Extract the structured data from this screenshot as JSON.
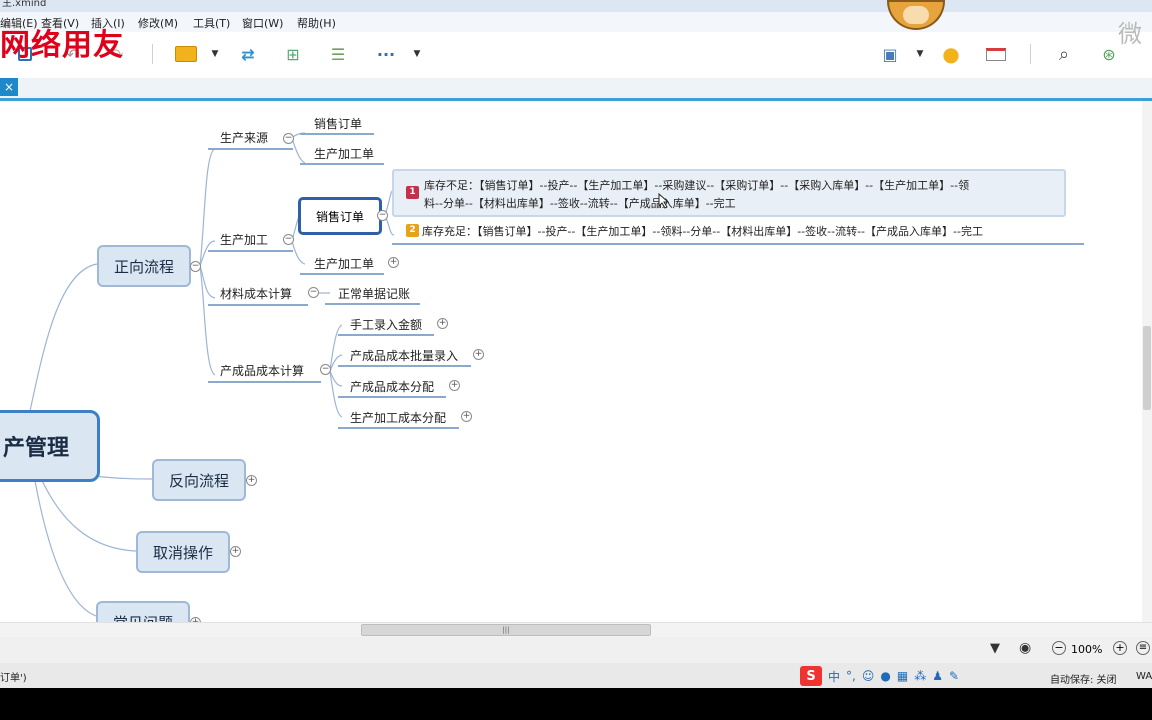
{
  "window": {
    "title": "主.xmind"
  },
  "watermark": "网络用友",
  "corner_watermark": "微",
  "menu": [
    "编辑(E)",
    "查看(V)",
    "插入(I)",
    "修改(M)",
    "工具(T)",
    "窗口(W)",
    "帮助(H)"
  ],
  "toolbar": {
    "more_label": "···"
  },
  "tab": {
    "close_label": "×"
  },
  "mindmap": {
    "central": "产管理",
    "branches": {
      "forward": "正向流程",
      "reverse": "反向流程",
      "cancel": "取消操作",
      "faq": "常见问题"
    },
    "subtopics": {
      "source": "生产来源",
      "processing": "生产加工",
      "material_cost": "材料成本计算",
      "product_cost": "产成品成本计算"
    },
    "leaves": {
      "source_sales_order": "销售订单",
      "source_work_order": "生产加工单",
      "proc_sales_order": "销售订单",
      "proc_work_order": "生产加工单",
      "normal_posting": "正常单据记账",
      "manual_amount": "手工录入金额",
      "batch_entry": "产成品成本批量录入",
      "product_alloc": "产成品成本分配",
      "work_alloc": "生产加工成本分配"
    },
    "notes": [
      {
        "badge": "1",
        "color": "#c4314b",
        "line1": "库存不足：【销售订单】--投产--【生产加工单】--采购建议--【采购订单】--【采购入库单】--【生产加工单】--领",
        "line2": "料--分单--【材料出库单】--签收--流转--【产成品入库单】--完工"
      },
      {
        "badge": "2",
        "color": "#e8a21a",
        "line1": "库存充足：【销售订单】--投产--【生产加工单】--领料--分单--【材料出库单】--签收--流转--【产成品入库单】--完工"
      }
    ]
  },
  "zoom": {
    "level": "100%",
    "minus": "−",
    "plus": "+"
  },
  "status": {
    "left": "订单')",
    "autosave": "自动保存: 关闭",
    "right": "WA"
  },
  "ime": {
    "logo": "S",
    "mode": "中",
    "punct": "°,"
  }
}
